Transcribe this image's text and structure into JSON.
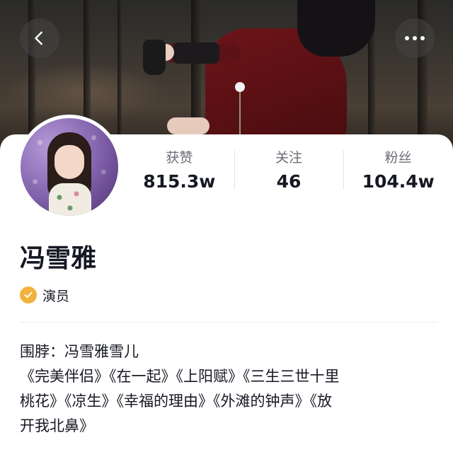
{
  "header": {
    "back_icon": "chevron-left-icon",
    "more_icon": "more-horizontal-icon"
  },
  "profile": {
    "name": "冯雪雅",
    "verification": {
      "icon": "verified-check-icon",
      "color": "#f2b23e",
      "label": "演员"
    }
  },
  "stats": [
    {
      "label": "获赞",
      "value": "815.3w"
    },
    {
      "label": "关注",
      "value": "46"
    },
    {
      "label": "粉丝",
      "value": "104.4w"
    }
  ],
  "bio": {
    "lines": [
      "围脖：冯雪雅雪儿",
      "《完美伴侣》《在一起》《上阳赋》《三生三世十里",
      "桃花》《凉生》《幸福的理由》《外滩的钟声》《放",
      "开我北鼻》"
    ]
  }
}
